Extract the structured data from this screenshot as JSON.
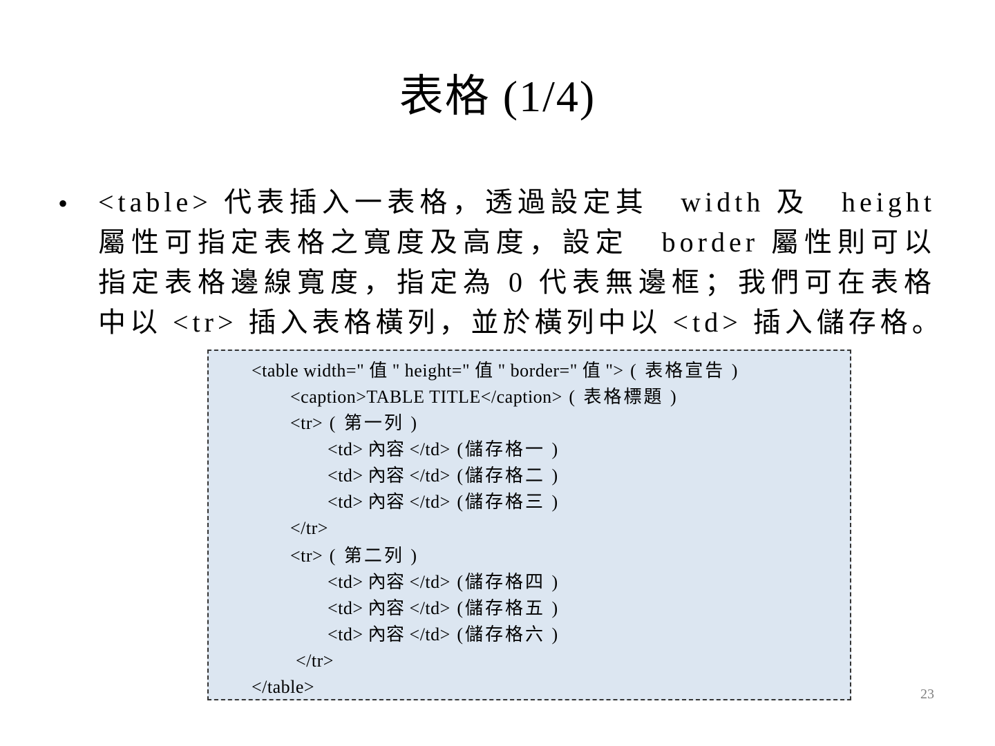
{
  "slide": {
    "title": "表格 (1/4)",
    "bullet_symbol": "•",
    "bullet_lines": [
      "<table> 代表插入一表格，透過設定其　width 及　height",
      "屬性可指定表格之寬度及高度，設定　border 屬性則可以",
      "指定表格邊線寬度，指定為 0 代表無邊框；我們可在表格",
      "中以 <tr> 插入表格橫列，並於橫列中以 <td> 插入儲存格。"
    ],
    "page_number": "23"
  },
  "code_box": {
    "lines": [
      {
        "code": "<table width=\" 值 \" height=\" 值 \" border=\" 值 \">",
        "note": " ( 表格宣告 )"
      },
      {
        "code": "<caption>TABLE TITLE</caption>",
        "note": " ( 表格標題 )"
      },
      {
        "code": "<tr>",
        "note": " ( 第一列 )"
      },
      {
        "code": "<td> 內容 </td>",
        "note": " (儲存格一 )"
      },
      {
        "code": "<td> 內容 </td>",
        "note": " (儲存格二 )"
      },
      {
        "code": "<td> 內容 </td>",
        "note": " (儲存格三 )"
      },
      {
        "code": "</tr>",
        "note": ""
      },
      {
        "code": "<tr>",
        "note": " ( 第二列 )"
      },
      {
        "code": "<td> 內容 </td>",
        "note": " (儲存格四 )"
      },
      {
        "code": "<td> 內容 </td>",
        "note": " (儲存格五 )"
      },
      {
        "code": "<td> 內容 </td>",
        "note": " (儲存格六 )"
      },
      {
        "code": "</tr>",
        "note": ""
      },
      {
        "code": "</table>",
        "note": ""
      }
    ]
  },
  "colors": {
    "code_box_background": "#dce6f1",
    "code_box_border": "#333333",
    "page_number": "#7f7f7f"
  }
}
